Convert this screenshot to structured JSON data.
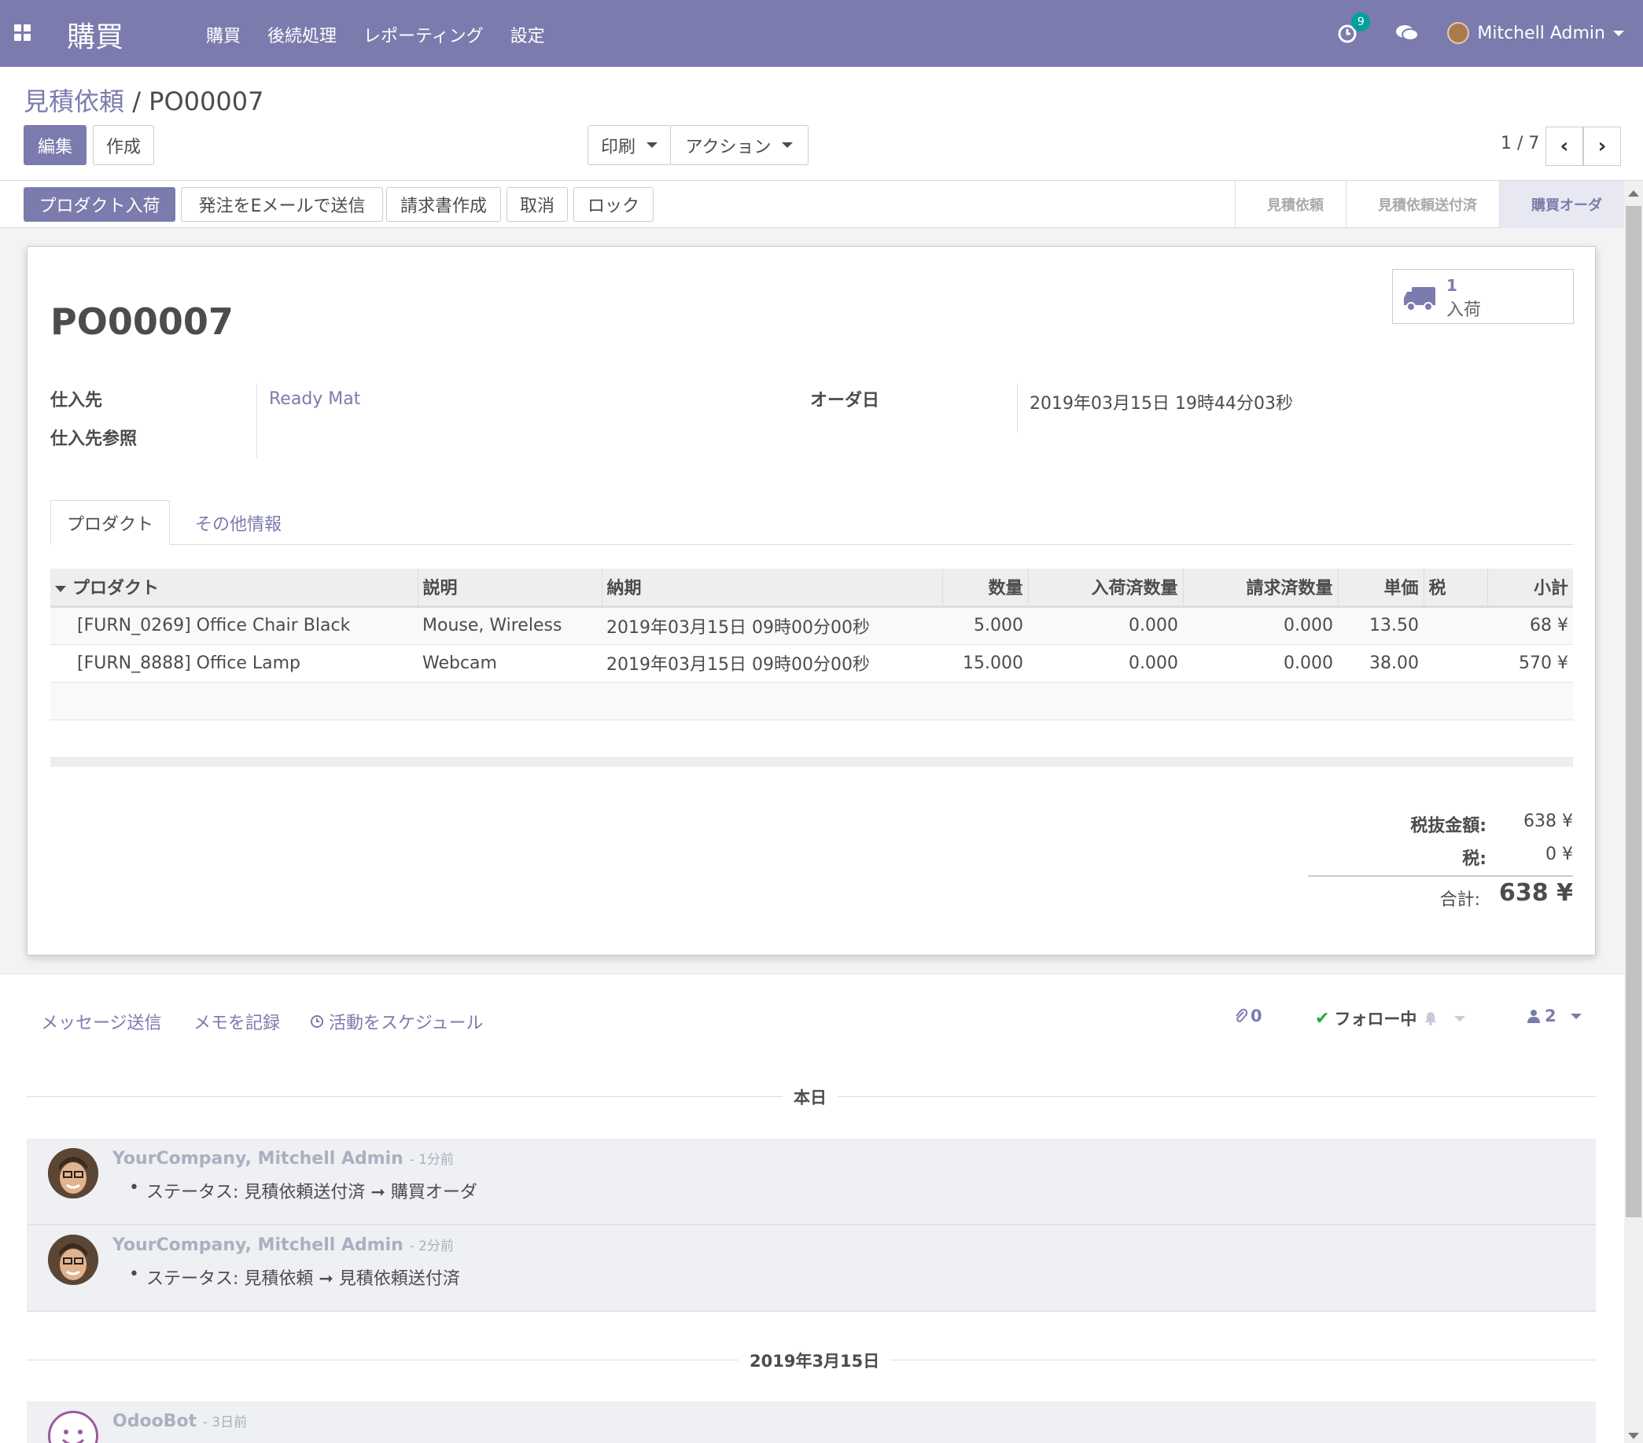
{
  "navbar": {
    "brand": "購買",
    "menu": [
      "購買",
      "後続処理",
      "レポーティング",
      "設定"
    ],
    "activity_count": "9",
    "user": "Mitchell Admin"
  },
  "breadcrumb": {
    "parent": "見積依頼",
    "separator": " / ",
    "current": "PO00007"
  },
  "buttons": {
    "edit": "編集",
    "create": "作成",
    "print": "印刷",
    "action": "アクション"
  },
  "pager": {
    "value": "1 / 7"
  },
  "header_buttons": [
    "プロダクト入荷",
    "発注をEメールで送信",
    "請求書作成",
    "取消",
    "ロック"
  ],
  "status_steps": [
    "見積依頼",
    "見積依頼送付済",
    "購買オーダ"
  ],
  "smart_button": {
    "count": "1",
    "label": "入荷"
  },
  "form": {
    "title": "PO00007",
    "vendor_label": "仕入先",
    "vendor_value": "Ready Mat",
    "vendor_ref_label": "仕入先参照",
    "order_date_label": "オーダ日",
    "order_date_value": "2019年03月15日 19時44分03秒"
  },
  "tabs": [
    "プロダクト",
    "その他情報"
  ],
  "table": {
    "columns": [
      "プロダクト",
      "説明",
      "納期",
      "数量",
      "入荷済数量",
      "請求済数量",
      "単価",
      "税",
      "小計"
    ],
    "rows": [
      [
        "[FURN_0269] Office Chair Black",
        "Mouse, Wireless",
        "2019年03月15日 09時00分00秒",
        "5.000",
        "0.000",
        "0.000",
        "13.50",
        "",
        "68 ¥"
      ],
      [
        "[FURN_8888] Office Lamp",
        "Webcam",
        "2019年03月15日 09時00分00秒",
        "15.000",
        "0.000",
        "0.000",
        "38.00",
        "",
        "570 ¥"
      ]
    ]
  },
  "totals": {
    "untaxed_label": "税抜金額:",
    "untaxed": "638 ¥",
    "tax_label": "税:",
    "tax": "0 ¥",
    "total_label": "合計:",
    "total": "638 ¥"
  },
  "chatter": {
    "send_message": "メッセージ送信",
    "log_note": "メモを記録",
    "schedule": "活動をスケジュール",
    "attachments": "0",
    "following": "フォロー中",
    "followers": "2",
    "today_label": "本日",
    "messages": [
      {
        "author": "YourCompany, Mitchell Admin",
        "ago": "1分前",
        "body": "ステータス: 見積依頼送付済 ➞ 購買オーダ"
      },
      {
        "author": "YourCompany, Mitchell Admin",
        "ago": "2分前",
        "body": "ステータス: 見積依頼 ➞ 見積依頼送付済"
      }
    ],
    "date2_label": "2019年3月15日",
    "bot": {
      "author": "OdooBot",
      "ago": "3日前"
    }
  },
  "colors": {
    "brand": "#7c7bad",
    "badge": "#00a09d",
    "check": "#28a745"
  }
}
